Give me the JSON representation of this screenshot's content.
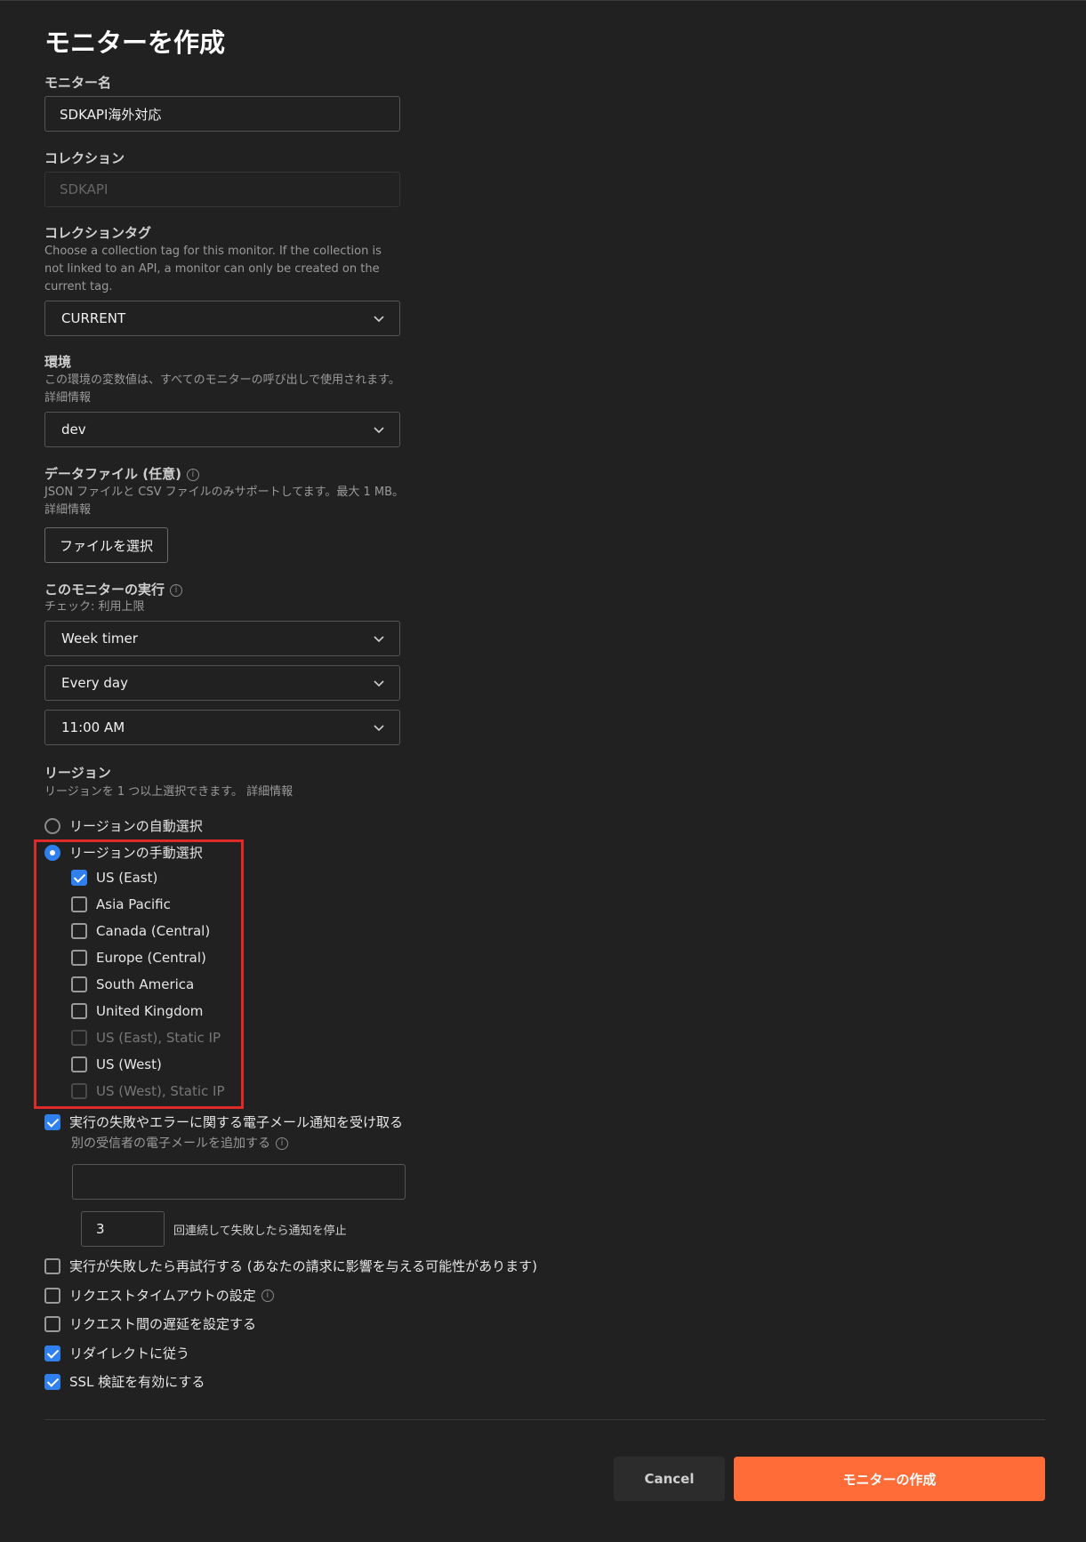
{
  "page_title": "モニターを作成",
  "monitor_name": {
    "label": "モニター名",
    "value": "SDKAPI海外対応"
  },
  "collection": {
    "label": "コレクション",
    "value": "SDKAPI"
  },
  "collection_tag": {
    "label": "コレクションタグ",
    "description": "Choose a collection tag for this monitor. If the collection is not linked to an API, a monitor can only be created on the current tag.",
    "value": "CURRENT"
  },
  "environment": {
    "label": "環境",
    "description": "この環境の変数値は、すべてのモニターの呼び出しで使用されます。",
    "link": "詳細情報",
    "value": "dev"
  },
  "data_file": {
    "label": "データファイル (任意)",
    "description": "JSON ファイルと CSV ファイルのみサポートしてます。最大 1 MB。",
    "link": "詳細情報",
    "button": "ファイルを選択"
  },
  "run": {
    "label": "このモニターの実行",
    "description": "チェック: 利用上限",
    "timer": "Week timer",
    "frequency": "Every day",
    "time": "11:00 AM"
  },
  "regions": {
    "label": "リージョン",
    "description": "リージョンを 1 つ以上選択できます。",
    "link": "詳細情報",
    "auto": "リージョンの自動選択",
    "manual": "リージョンの手動選択",
    "items": [
      {
        "label": "US (East)",
        "checked": true,
        "disabled": false
      },
      {
        "label": "Asia Pacific",
        "checked": false,
        "disabled": false
      },
      {
        "label": "Canada (Central)",
        "checked": false,
        "disabled": false
      },
      {
        "label": "Europe (Central)",
        "checked": false,
        "disabled": false
      },
      {
        "label": "South America",
        "checked": false,
        "disabled": false
      },
      {
        "label": "United Kingdom",
        "checked": false,
        "disabled": false
      },
      {
        "label": "US (East), Static IP",
        "checked": false,
        "disabled": true
      },
      {
        "label": "US (West)",
        "checked": false,
        "disabled": false
      },
      {
        "label": "US (West), Static IP",
        "checked": false,
        "disabled": true
      }
    ]
  },
  "notifications": {
    "email_label": "実行の失敗やエラーに関する電子メール通知を受け取る",
    "add_recipient": "別の受信者の電子メールを追加する",
    "recipient_value": "",
    "stop_count": "3",
    "stop_label": "回連続して失敗したら通知を停止"
  },
  "options": {
    "retry": "実行が失敗したら再試行する (あなたの請求に影響を与える可能性があります)",
    "timeout": "リクエストタイムアウトの設定",
    "delay": "リクエスト間の遅延を設定する",
    "redirect": "リダイレクトに従う",
    "ssl": "SSL 検証を有効にする"
  },
  "footer": {
    "cancel": "Cancel",
    "create": "モニターの作成"
  },
  "colors": {
    "accent": "#ff6c37",
    "checkbox": "#2f80ed",
    "highlight": "#e02a2a"
  }
}
